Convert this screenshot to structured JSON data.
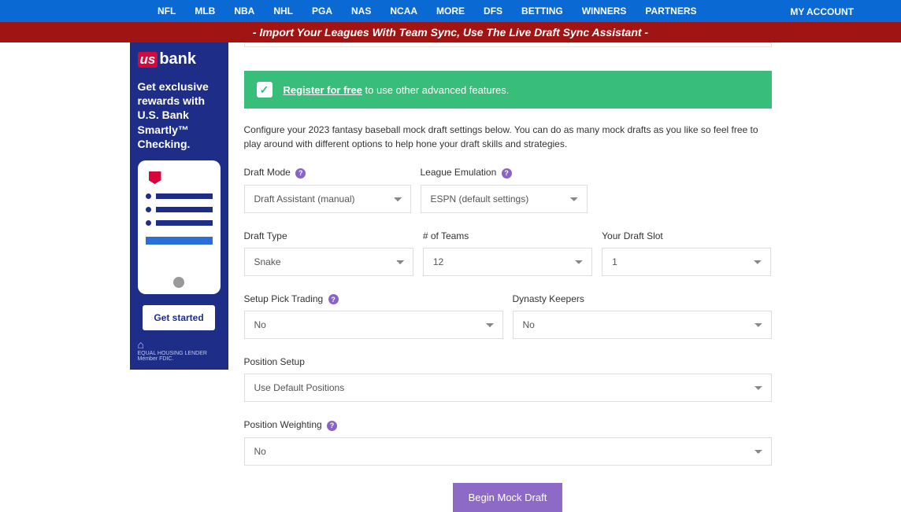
{
  "nav": {
    "items": [
      "NFL",
      "MLB",
      "NBA",
      "NHL",
      "PGA",
      "NAS",
      "NCAA",
      "MORE",
      "DFS",
      "BETTING",
      "WINNERS",
      "PARTNERS"
    ],
    "account": "MY ACCOUNT"
  },
  "redbar": "- Import Your Leagues With Team Sync, Use The Live Draft Sync Assistant -",
  "ad": {
    "logo1": "us",
    "logo2": "bank",
    "copy": "Get exclusive rewards with U.S. Bank Smartly™ Checking.",
    "cta": "Get started",
    "foot": "EQUAL HOUSING LENDER Member FDIC."
  },
  "banner": {
    "link": "Register for free",
    "rest": " to use other advanced features."
  },
  "intro": "Configure your 2023 fantasy baseball mock draft settings below. You can do as many mock drafts as you like so feel free to play around with different options to help hone your draft skills and strategies.",
  "fields": {
    "draftMode": {
      "label": "Draft Mode",
      "value": "Draft Assistant (manual)"
    },
    "leagueEmu": {
      "label": "League Emulation",
      "value": "ESPN (default settings)"
    },
    "draftType": {
      "label": "Draft Type",
      "value": "Snake"
    },
    "numTeams": {
      "label": "# of Teams",
      "value": "12"
    },
    "draftSlot": {
      "label": "Your Draft Slot",
      "value": "1"
    },
    "pickTrading": {
      "label": "Setup Pick Trading",
      "value": "No"
    },
    "dynasty": {
      "label": "Dynasty Keepers",
      "value": "No"
    },
    "posSetup": {
      "label": "Position Setup",
      "value": "Use Default Positions"
    },
    "posWeight": {
      "label": "Position Weighting",
      "value": "No"
    }
  },
  "submit": "Begin Mock Draft"
}
